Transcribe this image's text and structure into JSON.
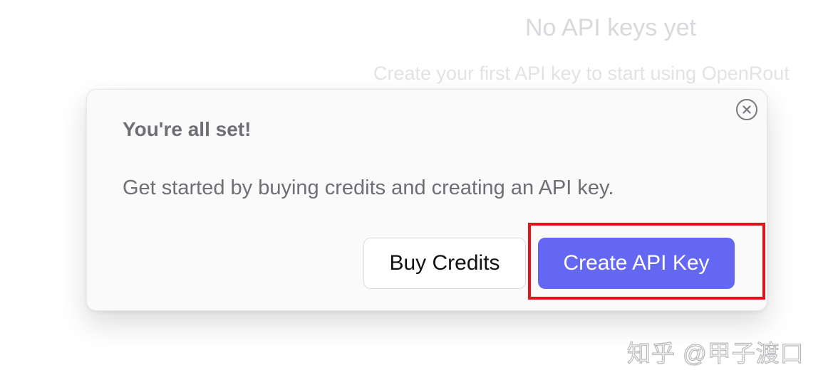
{
  "background": {
    "empty_title": "No API keys yet",
    "empty_subtitle": "Create your first API key to start using OpenRout"
  },
  "dialog": {
    "title": "You're all set!",
    "body": "Get started by buying credits and creating an API key.",
    "close_icon": "close-icon",
    "buttons": {
      "secondary_label": "Buy Credits",
      "primary_label": "Create API Key"
    }
  },
  "colors": {
    "primary_button": "#6467f2",
    "highlight_box": "#e3131b"
  },
  "watermark": "知乎 @甲子渡口"
}
